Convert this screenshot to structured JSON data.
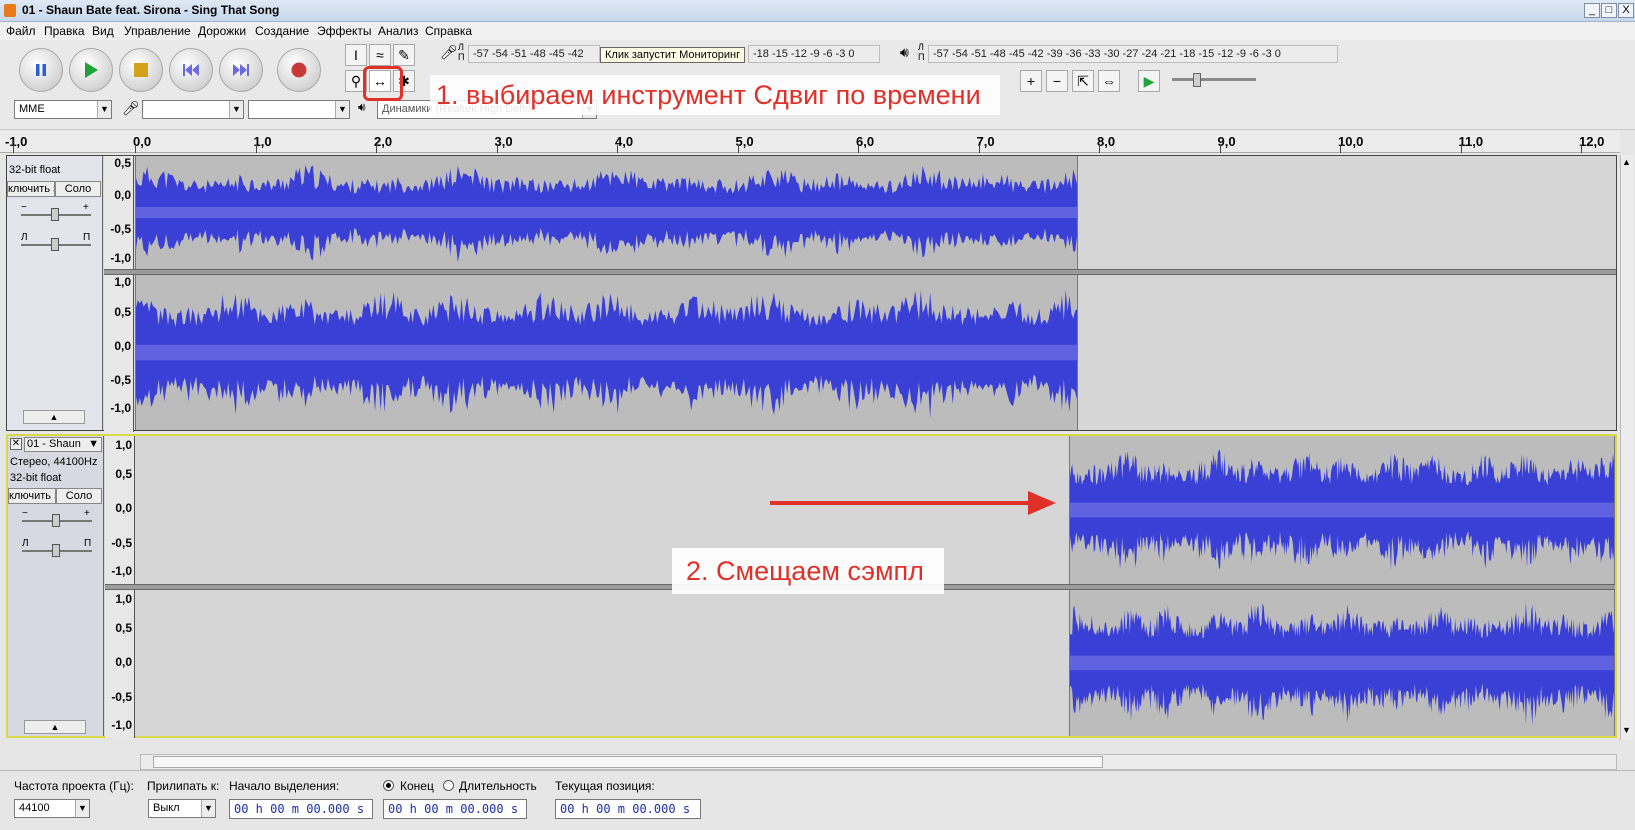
{
  "window": {
    "title": "01 - Shaun Bate feat. Sirona - Sing That Song",
    "controls": [
      "_",
      "□",
      "X"
    ]
  },
  "menu": [
    "Файл",
    "Правка",
    "Вид",
    "Управление",
    "Дорожки",
    "Создание",
    "Эффекты",
    "Анализ",
    "Справка"
  ],
  "meters": {
    "record_scale": "-57 -54 -51 -48 -45 -42",
    "record_scale_right": "-18 -15 -12 -9 -6 -3 0",
    "record_tip": "Клик запустит Мониторинг",
    "play_scale": "-57 -54 -51 -48 -45 -42 -39 -36 -33 -30 -27 -24 -21 -18 -15 -12 -9 -6 -3 0",
    "lr_left": "Л",
    "lr_right": "П"
  },
  "device": {
    "host": "MME",
    "output_label": "Динамики (Realtek High Definit"
  },
  "annotations": {
    "step1": "1. выбираем инструмент Сдвиг по времени",
    "step2": "2. Смещаем сэмпл"
  },
  "ruler": {
    "labels": [
      "-1,0",
      "0,0",
      "1,0",
      "2,0",
      "3,0",
      "4,0",
      "5,0",
      "6,0",
      "7,0",
      "8,0",
      "9,0",
      "10,0",
      "11,0",
      "12,0"
    ]
  },
  "track1": {
    "format_line1": "32-bit float",
    "mute": "ключить зву",
    "solo": "Соло",
    "gain_minus": "−",
    "gain_plus": "+",
    "pan_left": "Л",
    "pan_right": "П",
    "scale": [
      "0,5",
      "0,0",
      "-0,5",
      "-1,0"
    ],
    "scale2": [
      "1,0",
      "0,5",
      "0,0",
      "-0,5",
      "-1,0"
    ]
  },
  "track2": {
    "name": "01 - Shaun",
    "format_line1": "Стерео, 44100Hz",
    "format_line2": "32-bit float",
    "mute": "ключить зву",
    "solo": "Соло",
    "gain_minus": "−",
    "gain_plus": "+",
    "pan_left": "Л",
    "pan_right": "П",
    "scale": [
      "1,0",
      "0,5",
      "0,0",
      "-0,5",
      "-1,0"
    ],
    "scale2": [
      "1,0",
      "0,5",
      "0,0",
      "-0,5",
      "-1,0"
    ]
  },
  "status": {
    "rate_label": "Частота проекта (Гц):",
    "rate_value": "44100",
    "snap_label": "Прилипать к:",
    "snap_value": "Выкл",
    "sel_start_label": "Начало выделения:",
    "end_radio": "Конец",
    "length_radio": "Длительность",
    "position_label": "Текущая позиция:",
    "time_value": "00 h 00 m 00.000 s"
  },
  "colors": {
    "wave": "#3a3fd6",
    "wave_light": "#6f73e6",
    "annotation": "#e0302a",
    "selected_track_border": "#d8d84a"
  }
}
